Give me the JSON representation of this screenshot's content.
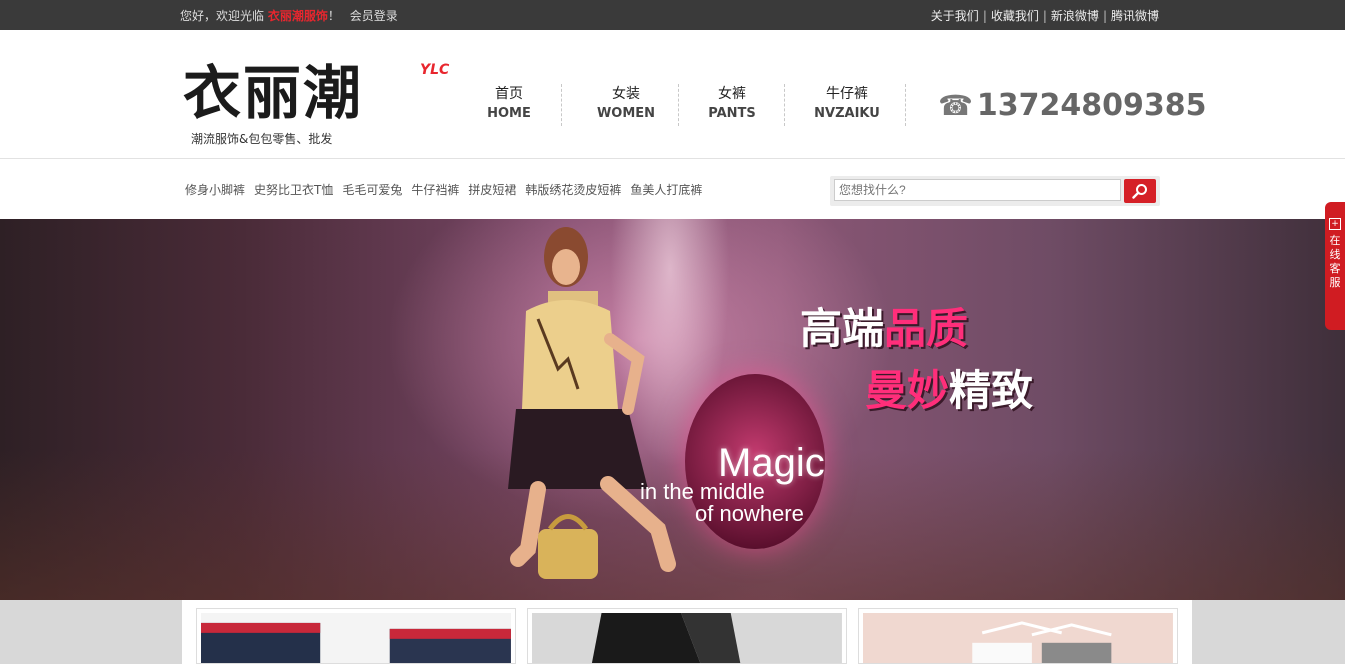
{
  "topbar": {
    "welcome_prefix": "您好，欢迎光临",
    "brand": "衣丽潮服饰",
    "welcome_suffix": "！",
    "login": "会员登录",
    "links": [
      "关于我们",
      "收藏我们",
      "新浪微博",
      "腾讯微博"
    ],
    "separator": "|"
  },
  "header": {
    "logo_text": "衣丽潮",
    "logo_badge": "YLC",
    "tagline": "潮流服饰&包包零售、批发",
    "nav": [
      {
        "cn": "首页",
        "en": "HOME"
      },
      {
        "cn": "女装",
        "en": "WOMEN"
      },
      {
        "cn": "女裤",
        "en": "PANTS"
      },
      {
        "cn": "牛仔裤",
        "en": "NVZAIKU"
      }
    ],
    "phone": "13724809385",
    "phone_icon": "telephone-icon"
  },
  "keywords": [
    "修身小脚裤",
    "史努比卫衣T恤",
    "毛毛可爱兔",
    "牛仔裆裤",
    "拼皮短裙",
    "韩版绣花烫皮短裤",
    "鱼美人打底裤"
  ],
  "search": {
    "placeholder": "您想找什么?",
    "button_icon": "search-icon"
  },
  "banner": {
    "headline1_white": "高端",
    "headline1_pink": "品质",
    "headline2_pink": "曼妙",
    "headline2_white": "精致",
    "magic": "Magic",
    "magic_sub1": "in the middle",
    "magic_sub2": "of nowhere"
  },
  "chat_tab": {
    "label": "在线客服"
  },
  "colors": {
    "accent": "#e8262e",
    "topbar": "#3a3a3a",
    "headline_pink": "#ff2e7a"
  }
}
